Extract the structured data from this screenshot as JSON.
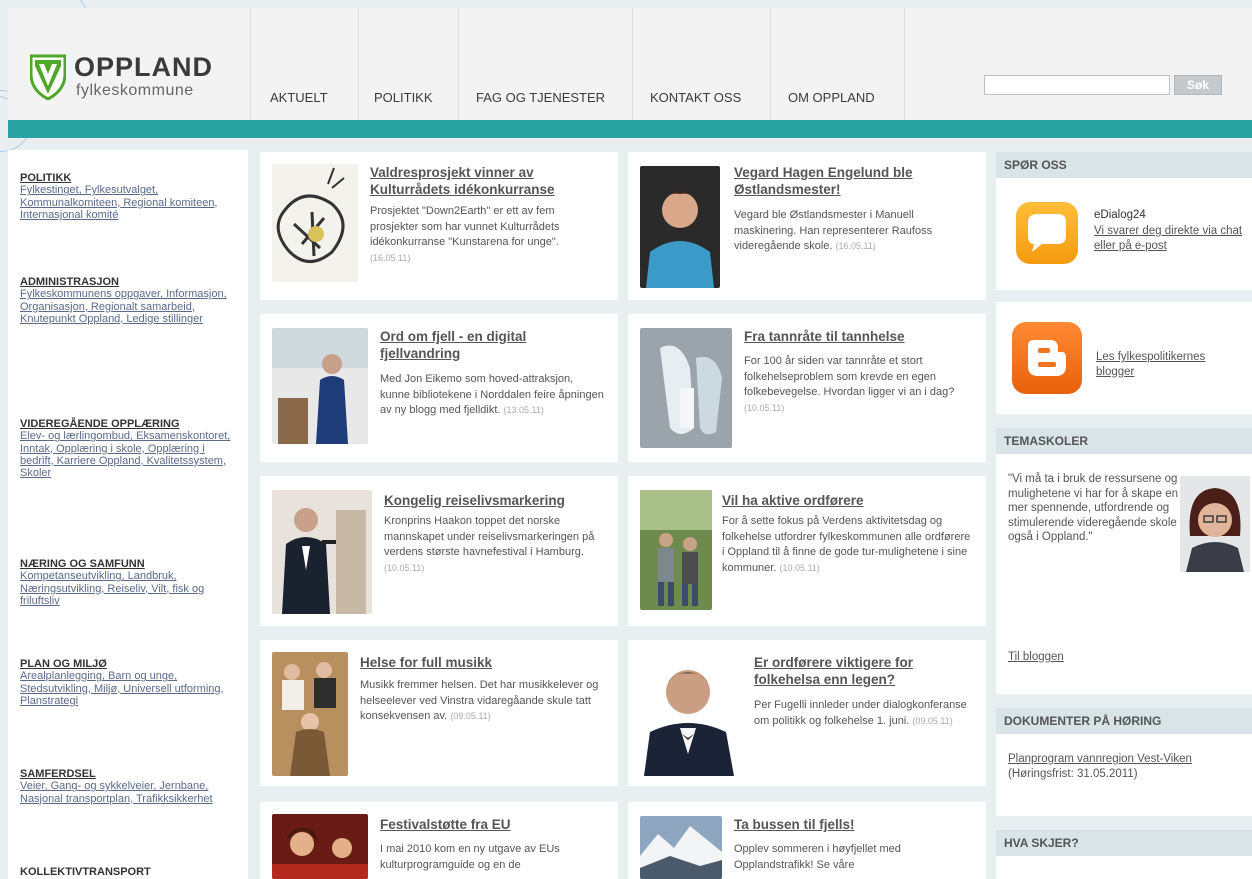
{
  "brand": {
    "name": "OPPLAND",
    "sub": "fylkeskommune"
  },
  "nav": [
    {
      "label": "AKTUELT"
    },
    {
      "label": "POLITIKK"
    },
    {
      "label": "FAG OG TJENESTER"
    },
    {
      "label": "KONTAKT OSS"
    },
    {
      "label": "OM OPPLAND"
    }
  ],
  "search": {
    "placeholder": "",
    "button": "Søk"
  },
  "colors": {
    "teal": "#2aa4a2",
    "logo_green": "#4fa82a",
    "link": "#3f4a6a"
  },
  "sidebar": [
    {
      "head": "POLITIKK",
      "links": "Fylkestinget, Fylkesutvalget, Kommunalkomiteen, Regional komiteen, Internasjonal komité"
    },
    {
      "head": "ADMINISTRASJON",
      "links": "Fylkeskommunens oppgaver, Informasjon, Organisasjon, Regionalt samarbeid, Knutepunkt Oppland, Ledige stillinger"
    },
    {
      "head": "VIDEREGÅENDE OPPLÆRING",
      "links": "Elev- og lærlingombud, Eksamenskontoret, Inntak, Opplæring i skole, Opplæring i bedrift, Karriere Oppland, Kvalitetssystem, Skoler"
    },
    {
      "head": "NÆRING OG SAMFUNN",
      "links": "Kompetanseutvikling, Landbruk, Næringsutvikling, Reiseliv, Vilt, fisk og friluftsliv"
    },
    {
      "head": "PLAN OG MILJØ",
      "links": "Arealplanlegging, Barn og unge, Stedsutvikling, Miljø, Universell utforming, Planstrategi"
    },
    {
      "head": "SAMFERDSEL",
      "links": "Veier, Gang- og sykkelveier, Jernbane, Nasjonal transportplan, Trafikksikkerhet"
    },
    {
      "head": "KOLLEKTIVTRANSPORT",
      "links": ""
    }
  ],
  "news": [
    {
      "title": "Valdresprosjekt vinner av Kulturrådets idékonkurranse",
      "text": "Prosjektet \"Down2Earth\" er ett av fem prosjekter som har vunnet Kulturrådets idékonkurranse \"Kunstarena for unge\".",
      "date": "(16.05.11)",
      "thumb": "drawing"
    },
    {
      "title": "Vegard Hagen Engelund ble Østlandsmester!",
      "text": "Vegard ble Østlandsmester i Manuell maskinering. Han representerer Raufoss videregående skole.",
      "date": "(16.05.11)",
      "thumb": "student"
    },
    {
      "title": "Ord om fjell - en digital fjellvandring",
      "text": "Med Jon Eikemo som hoved-attraksjon, kunne bibliotekene i Norddalen feire åpningen av ny blogg med fjelldikt.",
      "date": "(13.05.11)",
      "thumb": "speaker"
    },
    {
      "title": "Fra tannråte til tannhelse",
      "text": "For 100 år siden var tannråte et stort folkehelseproblem som krevde en egen folkebevegelse. Hvordan ligger vi an i dag?",
      "date": "(10.05.11)",
      "thumb": "teeth"
    },
    {
      "title": "Kongelig reiselivsmarkering",
      "text": "Kronprins Haakon toppet det norske mannskapet under reiselivsmarkeringen på verdens største havnefestival i Hamburg.",
      "date": "(10.05.11)",
      "thumb": "prince"
    },
    {
      "title": "Vil ha aktive ordførere",
      "text": "For å sette fokus på Verdens aktivitetsdag og folkehelse utfordrer fylkeskommunen alle ordførere i Oppland til å finne de gode tur-mulighetene i sine kommuner.",
      "date": "(10.05.11)",
      "thumb": "walkers"
    },
    {
      "title": "Helse for full musikk",
      "text": "Musikk fremmer helsen. Det har musikkelever og helseelever ved Vinstra vidaregåande skule tatt konsekvensen av.",
      "date": "(09.05.11)",
      "thumb": "musicians"
    },
    {
      "title": "Er ordførere viktigere for folkehelsa enn legen?",
      "text": "Per Fugelli innleder under dialogkonferanse om politikk og folkehelse 1. juni.",
      "date": "(09.05.11)",
      "thumb": "man"
    },
    {
      "title": "Festivalstøtte fra EU",
      "text": "I mai 2010 kom en ny utgave av EUs kulturprogramguide og en de",
      "date": "",
      "thumb": "festival"
    },
    {
      "title": "Ta bussen til fjells!",
      "text": "Opplev sommeren i høyfjellet med Opplandstrafikk! Se våre",
      "date": "",
      "thumb": "mountain"
    }
  ],
  "right": {
    "spor_oss": {
      "head": "SPØR OSS",
      "edialog_title": "eDialog24",
      "edialog_link": "Vi svarer deg direkte via chat eller på e-post",
      "blog_link": "Les fylkespolitikernes blogger"
    },
    "temaskoler": {
      "head": "TEMASKOLER",
      "quote": "\"Vi må ta i bruk de ressursene og mulighetene vi har for å skape en mer spennende, utfordrende og stimulerende videregående skole også i Oppland.\"",
      "link": "Til bloggen"
    },
    "dokumenter": {
      "head": "DOKUMENTER PÅ HØRING",
      "link": "Planprogram vannregion Vest-Viken",
      "note": "(Høringsfrist: 31.05.2011)"
    },
    "hva_skjer": {
      "head": "HVA SKJER?"
    }
  }
}
